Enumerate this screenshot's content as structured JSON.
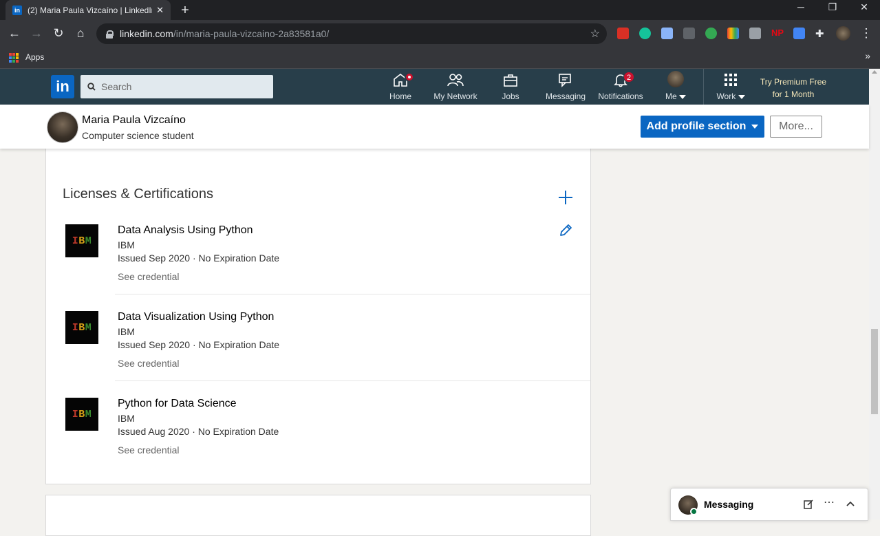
{
  "browser": {
    "tab_title": "(2) Maria Paula Vizcaíno | LinkedIn",
    "tab_favicon": "in",
    "url_host": "linkedin.com",
    "url_path": "/in/maria-paula-vizcaino-2a83581a0/",
    "bookmarks_apps": "Apps",
    "extension_icons": [
      "pdf-icon",
      "grammarly-icon",
      "camera-icon",
      "check-icon",
      "reader-icon",
      "color-grid-icon",
      "card-icon",
      "netflix-party-icon",
      "window-icon",
      "puzzle-icon",
      "profile-icon"
    ]
  },
  "nav": {
    "search_placeholder": "Search",
    "items": [
      {
        "label": "Home",
        "icon": "home-icon"
      },
      {
        "label": "My Network",
        "icon": "network-icon"
      },
      {
        "label": "Jobs",
        "icon": "briefcase-icon"
      },
      {
        "label": "Messaging",
        "icon": "messaging-icon"
      },
      {
        "label": "Notifications",
        "icon": "bell-icon",
        "badge": "2"
      },
      {
        "label": "Me",
        "icon": "avatar-icon"
      },
      {
        "label": "Work",
        "icon": "grid-icon"
      }
    ],
    "premium_line1": "Try Premium Free",
    "premium_line2": "for 1 Month"
  },
  "profile": {
    "name": "Maria Paula Vizcaíno",
    "headline": "Computer science student",
    "add_section_label": "Add profile section",
    "more_label": "More..."
  },
  "licenses": {
    "title": "Licenses & Certifications",
    "items": [
      {
        "name": "Data Analysis Using Python",
        "org": "IBM",
        "issued": "Issued Sep 2020 · No Expiration Date",
        "link": "See credential"
      },
      {
        "name": "Data Visualization Using Python",
        "org": "IBM",
        "issued": "Issued Sep 2020 · No Expiration Date",
        "link": "See credential"
      },
      {
        "name": "Python for Data Science",
        "org": "IBM",
        "issued": "Issued Aug 2020 · No Expiration Date",
        "link": "See credential"
      }
    ],
    "logo_text": [
      "I",
      "B",
      "M"
    ]
  },
  "messaging": {
    "label": "Messaging"
  },
  "colors": {
    "linkedin_blue": "#0a66c2",
    "nav_bg": "#283e4a",
    "badge_red": "#cb112d"
  }
}
